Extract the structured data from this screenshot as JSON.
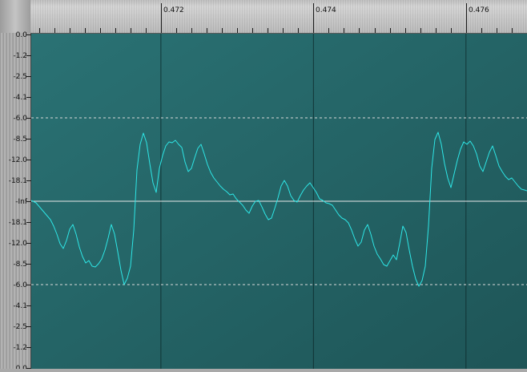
{
  "time_ruler": {
    "start": 0.4703,
    "end": 0.4768,
    "labels": [
      "0.472",
      "0.474",
      "0.476"
    ],
    "label_values": [
      0.472,
      0.474,
      0.476
    ],
    "minor_step": 0.0002
  },
  "db_scale": {
    "labels": [
      "0.0",
      "-1.2",
      "-2.5",
      "-4.1",
      "-6.0",
      "-8.5",
      "-12.0",
      "-18.1",
      "-Inf",
      "-18.1",
      "-12.0",
      "-8.5",
      "-6.0",
      "-4.1",
      "-2.5",
      "-1.2",
      "0.0"
    ],
    "amplitudes": [
      1.0,
      0.875,
      0.75,
      0.625,
      0.5,
      0.375,
      0.25,
      0.125,
      0,
      -0.125,
      -0.25,
      -0.375,
      -0.5,
      -0.625,
      -0.75,
      -0.875,
      -1.0
    ],
    "guide_db": "-6.0"
  },
  "colors": {
    "waveform": "#2ee6e6",
    "background_left": "#2a7274",
    "background_right": "#1e5557",
    "center_line": "#e8e8e8",
    "guide_line": "#d9d9d9",
    "ruler_text": "#111111"
  }
}
